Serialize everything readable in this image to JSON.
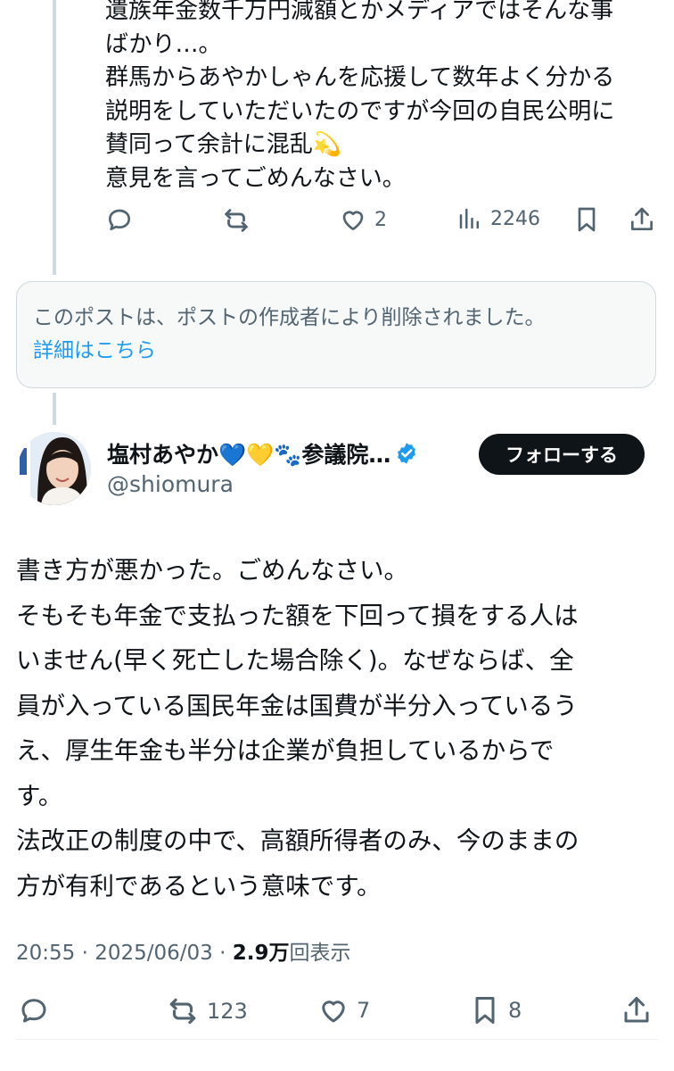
{
  "reply": {
    "text": "遺族年金数千万円減額とかメディアではそんな事\nばかり…。\n群馬からあやかしゃんを応援して数年よく分かる\n説明をしていただいたのですが今回の自民公明に\n賛同って余計に混乱💫\n意見を言ってごめんなさい。",
    "actions": {
      "reply_count": "",
      "repost_count": "",
      "like_count": "2",
      "view_count": "2246"
    }
  },
  "deleted_notice": {
    "message": "このポストは、ポストの作成者により削除されました。",
    "link": "詳細はこちら"
  },
  "post": {
    "author_name": "塩村あやか💙💛🐾参議院…",
    "handle": "@shiomura",
    "follow_label": "フォローする",
    "text": "書き方が悪かった。ごめんなさい。\nそもそも年金で支払った額を下回って損をする人は\nいません(早く死亡した場合除く)。なぜならば、全\n員が入っている国民年金は国費が半分入っているう\nえ、厚生年金も半分は企業が負担しているからで\nす。\n法改正の制度の中で、高額所得者のみ、今のままの\n方が有利であるという意味です。",
    "time": "20:55",
    "separator": " · ",
    "date": "2025/06/03",
    "views_value": "2.9万",
    "views_label": "回表示",
    "actions": {
      "repost_count": "123",
      "like_count": "7",
      "bookmark_count": "8"
    }
  },
  "colors": {
    "text": "#0f1419",
    "muted": "#536471",
    "link": "#1d9bf0",
    "verified": "#1d9bf0",
    "thread_line": "#cfd9de"
  }
}
